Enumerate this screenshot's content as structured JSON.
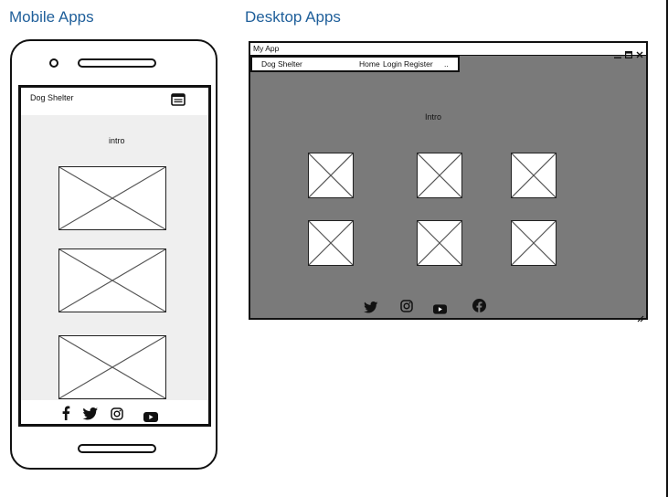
{
  "headings": {
    "mobile": "Mobile Apps",
    "desktop": "Desktop Apps"
  },
  "mobile": {
    "brand": "Dog Shelter",
    "intro": "intro",
    "menu_icon": "menu-icon",
    "social_icons": [
      "facebook-icon",
      "twitter-icon",
      "instagram-icon",
      "youtube-icon"
    ]
  },
  "desktop": {
    "window_title": "My App",
    "brand": "Dog Shelter",
    "nav": {
      "home": "Home",
      "login": "Login",
      "register": "Register",
      "more": ".."
    },
    "intro": "Intro",
    "social_icons": [
      "twitter-icon",
      "instagram-icon",
      "youtube-icon",
      "facebook-icon"
    ]
  }
}
